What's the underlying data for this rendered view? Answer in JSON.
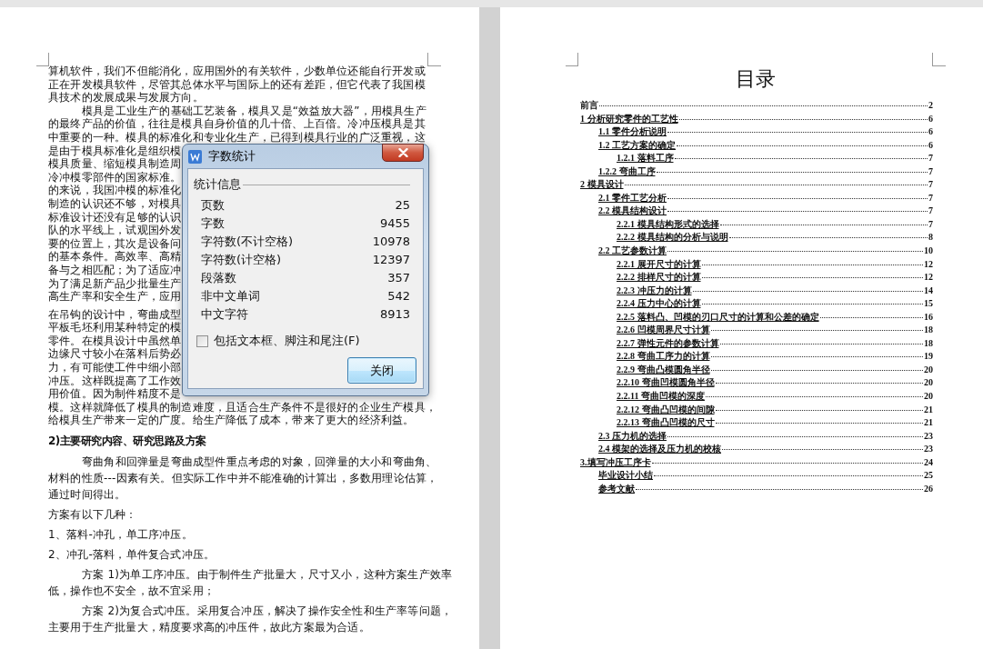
{
  "left_page": {
    "upper_paragraphs": [
      {
        "kind": "paragraph",
        "indented": false,
        "lines": [
          "算机软件，我们不但能消化，应用国外的有关软件，少数单位还能自行开发或",
          "正在开发模具软件，尽管其总体水平与国际上的还有差距，但它代表了我国模",
          "具技术的发展成果与发展方向。"
        ]
      },
      {
        "kind": "paragraph",
        "indented": true,
        "lines": [
          "模具是工业生产的基础工艺装备，模具又是“效益放大器”，用模具生产",
          "的最终产品的价值，往往是模具自身价值的几十倍、上百倍。冷冲压模具是其",
          "中重要的一种。模具的标准化和专业化生产，已得到模具行业的广泛重视，这"
        ]
      },
      {
        "kind": "line",
        "text": "是由于模具标准化是组织模"
      },
      {
        "kind": "line",
        "text": "模具质量、缩短模具制造周"
      },
      {
        "kind": "line",
        "text": "冷冲模零部件的国家标准。"
      },
      {
        "kind": "line",
        "text": "的来说，我国冲模的标准化"
      },
      {
        "kind": "line",
        "text": "制造的认识还不够，对模具"
      },
      {
        "kind": "line",
        "text": "标准设计还没有足够的认识"
      },
      {
        "kind": "line",
        "text": "队的水平线上，试观国外发"
      },
      {
        "kind": "line",
        "text": "要的位置上，其次是设备问"
      },
      {
        "kind": "line",
        "text": "的基本条件。高效率、高精"
      },
      {
        "kind": "line",
        "text": "备与之相匹配；为了适应冲"
      },
      {
        "kind": "line",
        "text": "为了满足新产品少批量生产"
      },
      {
        "kind": "line",
        "text": "高生产率和安全生产，应用"
      },
      {
        "kind": "paragraph_start_line",
        "text": "在吊钩的设计中，弯曲成型"
      },
      {
        "kind": "line",
        "text": "平板毛坯利用某种特定的模"
      },
      {
        "kind": "line",
        "text": "零件。在模具设计中虽然单"
      },
      {
        "kind": "line",
        "text": "边缘尺寸较小在落料后势必"
      },
      {
        "kind": "line",
        "text": "力，有可能使工件中细小部"
      },
      {
        "kind": "line",
        "text": "冲压。这样既提高了工作效"
      },
      {
        "kind": "line",
        "text": "用价值。因为制件精度不是"
      },
      {
        "kind": "paragraph",
        "indented": false,
        "lines": [
          "模。这样就降低了模具的制造难度，且适合生产条件不是很好的企业生产模具，",
          "给模具生产带来一定的广度。给生产降低了成本，带来了更大的经济利益。"
        ]
      }
    ],
    "heading": "2)主要研究内容、研究思路及方案",
    "lower_paragraphs": [
      {
        "indented": true,
        "lines": [
          "弯曲角和回弹量是弯曲成型件重点考虑的对象，回弹量的大小和弯曲角、",
          "材料的性质---因素有关。但实际工作中并不能准确的计算出，多数用理论估算，",
          "通过时间得出。"
        ]
      },
      {
        "indented": false,
        "lines": [
          "方案有以下几种："
        ]
      },
      {
        "indented": false,
        "lines": [
          "1、落料-冲孔，单工序冲压。"
        ]
      },
      {
        "indented": false,
        "lines": [
          "2、冲孔-落料，单件复合式冲压。"
        ]
      },
      {
        "indented": true,
        "lines": [
          "方案 1)为单工序冲压。由于制件生产批量大，尺寸又小，这种方案生产效率",
          "低，操作也不安全，故不宜采用；"
        ]
      },
      {
        "indented": true,
        "lines": [
          "方案 2)为复合式冲压。采用复合冲压，解决了操作安全性和生产率等问题，",
          "主要用于生产批量大，精度要求高的冲压件，故此方案最为合适。"
        ]
      }
    ]
  },
  "right_page": {
    "title": "目录",
    "toc": [
      {
        "title": "前言",
        "page": "2",
        "hyperlink": false
      },
      {
        "title": "1   分析研究零件的工艺性",
        "page": "6",
        "hyperlink": true,
        "children": [
          {
            "title": "1.1 零件分析说明",
            "page": "6",
            "hyperlink": true
          },
          {
            "title": "1.2 工艺方案的确定",
            "page": "6",
            "hyperlink": true,
            "children": [
              {
                "title": "1.2.1 落料工序",
                "page": "7",
                "hyperlink": true
              }
            ]
          },
          {
            "title": "1.2.2 弯曲工序",
            "page": "7",
            "hyperlink": true
          }
        ]
      },
      {
        "title": "2 模具设计",
        "page": "7",
        "hyperlink": true,
        "children": [
          {
            "title": "2.1 零件工艺分析",
            "page": "7",
            "hyperlink": true
          },
          {
            "title": "2.2 模具结构设计",
            "page": "7",
            "hyperlink": true,
            "children": [
              {
                "title": "2.2.1 模具结构形式的选择",
                "page": "7",
                "hyperlink": true
              },
              {
                "title": "2.2.2 模具结构的分析与说明",
                "page": "8",
                "hyperlink": true
              }
            ]
          },
          {
            "title": "2.2 工艺参数计算",
            "page": "10",
            "hyperlink": true,
            "children": [
              {
                "title": "2.2.1 展开尺寸的计算",
                "page": "12",
                "hyperlink": true
              },
              {
                "title": "2.2.2  排样尺寸的计算",
                "page": "12",
                "hyperlink": true
              },
              {
                "title": "2.2.3 冲压力的计算",
                "page": "14",
                "hyperlink": true
              },
              {
                "title": "2.2.4 压力中心的计算",
                "page": "15",
                "hyperlink": true
              },
              {
                "title": "2.2.5 落料凸、凹模的刃口尺寸的计算和公差的确定",
                "page": "16",
                "hyperlink": true
              },
              {
                "title": "2.2.6 凹模周界尺寸计算",
                "page": "18",
                "hyperlink": true
              },
              {
                "title": "2.2.7 弹性元件的参数计算",
                "page": "18",
                "hyperlink": true
              },
              {
                "title": "2.2.8 弯曲工序力的计算",
                "page": "19",
                "hyperlink": true
              },
              {
                "title": "2.2.9 弯曲凸模圆角半径",
                "page": "20",
                "hyperlink": true
              },
              {
                "title": "2.2.10 弯曲凹模圆角半径",
                "page": "20",
                "hyperlink": true
              },
              {
                "title": "2.2.11 弯曲凹模的深度",
                "page": "20",
                "hyperlink": true
              },
              {
                "title": "2.2.12 弯曲凸凹模的间隙",
                "page": "21",
                "hyperlink": true
              },
              {
                "title": "2.2.13 弯曲凸凹模的尺寸",
                "page": "21",
                "hyperlink": true
              }
            ]
          },
          {
            "title": "2.3 压力机的选择",
            "page": "23",
            "hyperlink": true
          },
          {
            "title": "2.4 模架的选择及压力机的校核",
            "page": "23",
            "hyperlink": true
          }
        ]
      },
      {
        "title": "3.填写冲压工序卡",
        "page": "24",
        "hyperlink": true,
        "children": [
          {
            "title": "毕业设计小结",
            "page": "25",
            "hyperlink": true
          },
          {
            "title": "参考文献",
            "page": "26",
            "hyperlink": true
          }
        ]
      }
    ]
  },
  "dialog": {
    "title": "字数统计",
    "group_label": "统计信息",
    "stats": [
      {
        "label": "页数",
        "value": "25"
      },
      {
        "label": "字数",
        "value": "9455"
      },
      {
        "label": "字符数(不计空格)",
        "value": "10978"
      },
      {
        "label": "字符数(计空格)",
        "value": "12397"
      },
      {
        "label": "段落数",
        "value": "357"
      },
      {
        "label": "非中文单词",
        "value": "542"
      },
      {
        "label": "中文字符",
        "value": "8913"
      }
    ],
    "checkbox": {
      "label": "包括文本框、脚注和尾注(F)",
      "checked": false
    },
    "button": "关闭"
  }
}
